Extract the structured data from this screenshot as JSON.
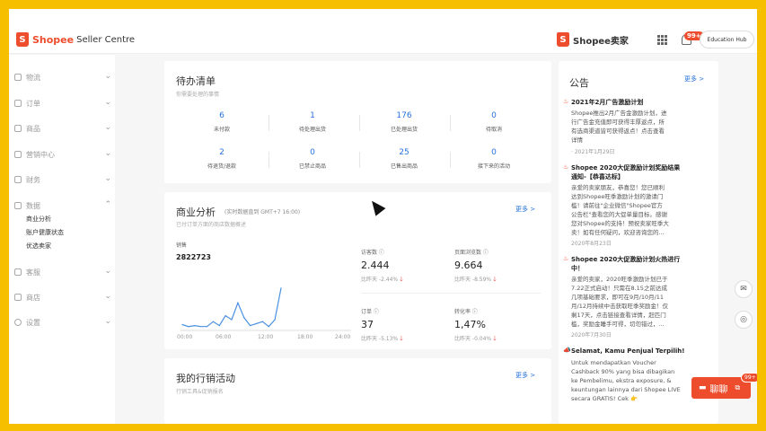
{
  "header": {
    "brand_shopee": "Shopee",
    "brand_title": "Seller Centre",
    "brand2": "Shopee卖家",
    "notif_count": "99+",
    "education_hub": "Education Hub"
  },
  "sidebar": {
    "items": [
      {
        "label": "物流"
      },
      {
        "label": "订单"
      },
      {
        "label": "商品"
      },
      {
        "label": "营销中心"
      },
      {
        "label": "财务"
      },
      {
        "label": "数据"
      },
      {
        "label": "客服"
      },
      {
        "label": "商店"
      },
      {
        "label": "设置"
      }
    ],
    "data_subitems": [
      "商业分析",
      "账户健康状态",
      "优选卖家"
    ]
  },
  "todo": {
    "title": "待办清单",
    "subtitle": "你需要处理的事情",
    "items": [
      {
        "value": "6",
        "label": "未付款"
      },
      {
        "value": "1",
        "label": "待处理出货"
      },
      {
        "value": "176",
        "label": "已处理出货"
      },
      {
        "value": "0",
        "label": "待取消"
      },
      {
        "value": "2",
        "label": "待退货/退款"
      },
      {
        "value": "0",
        "label": "已禁止商品"
      },
      {
        "value": "25",
        "label": "已售出商品"
      },
      {
        "value": "0",
        "label": "接下来的活动"
      }
    ]
  },
  "analytics": {
    "title": "商业分析",
    "realtime_note": "(实时数据直到 GMT+7 16:00)",
    "subtitle": "已付订单方面的商店数据概述",
    "more": "更多 >",
    "sales_label": "销售",
    "sales_value": "2822723",
    "visitors_label": "访客数",
    "visitors_value": "2.444",
    "visitors_cmp": "比昨天 -2.44%",
    "pageviews_label": "页面浏览数",
    "pageviews_value": "9.664",
    "pageviews_cmp": "比昨天 -8.59%",
    "orders_label": "订单",
    "orders_value": "37",
    "orders_cmp": "比昨天 -5.13%",
    "conversion_label": "转化率",
    "conversion_value": "1,47%",
    "conversion_cmp": "比昨天 -0.04%",
    "x_ticks": [
      "00:00",
      "06:00",
      "12:00",
      "18:00",
      "24:00"
    ]
  },
  "chart_data": {
    "type": "line",
    "x": [
      0,
      1,
      2,
      3,
      4,
      5,
      6,
      7,
      8,
      9,
      10,
      11,
      12,
      13,
      14,
      15,
      16
    ],
    "y": [
      5,
      3,
      4,
      3,
      3,
      8,
      4,
      14,
      10,
      27,
      12,
      4,
      6,
      8,
      3,
      10,
      42
    ],
    "xlabel": "",
    "ylabel": "",
    "x_tick_labels": [
      "00:00",
      "06:00",
      "12:00",
      "18:00",
      "24:00"
    ],
    "ylim": [
      0,
      60
    ],
    "color": "#4a90e2"
  },
  "marketing": {
    "title": "我的行销活动",
    "subtitle": "行销工具&促销报名",
    "more": "更多 >"
  },
  "announcements": {
    "title": "公告",
    "more": "更多 >",
    "items": [
      {
        "title": "2021年2月广告激励计划",
        "body": [
          "Shopee推出2月广告金激励计划，进",
          "行广告金充值即可获得丰厚返点，所",
          "有选商渠道皆可获得返点！点击查看",
          "详情"
        ],
        "date": "· 2021年1月29日"
      },
      {
        "title": "Shopee 2020大促激励计划奖励结果",
        "title2": "通知-【恭喜达标】",
        "body": [
          "亲爱的卖家朋友，恭喜您！您已顺利",
          "达到Shopee旺季激励计划的激请门",
          "槛！请前往\"企业微信\"Shopee官方",
          "公告栏\"查看您的大促单量目标。感谢",
          "您对Shopee的支持！预祝卖家旺季大",
          "卖！如有任何疑问，欢迎咨询您的..."
        ],
        "date": "2020年8月23日"
      },
      {
        "title": "Shopee 2020大促激励计划火热进行",
        "title2": "中！",
        "body": [
          "亲爱的卖家，2020旺季激励计划已于",
          "7.22正式启动！只需在8.15之前达成",
          "几项基础要求，即可在9月/10月/11",
          "月/12月持续中击获取旺季奖励金！仅",
          "剩17天，点击链接查看详情，赶匹门",
          "槛，奖励金睡手可得，切勿错过，..."
        ],
        "date": "2020年7月30日"
      },
      {
        "title": "Selamat, Kamu Penjual Terpilih!",
        "body": [
          "Untuk mendapatkan Voucher",
          "Cashback 90% yang bisa dibagikan",
          "ke Pembelimu, ekstra exposure, &",
          "keuntungan lainnya dari Shopee LIVE",
          "secara GRATIS! Cek 👉"
        ],
        "date": ""
      }
    ]
  },
  "chat": {
    "label": "聊聊",
    "badge": "99+"
  }
}
